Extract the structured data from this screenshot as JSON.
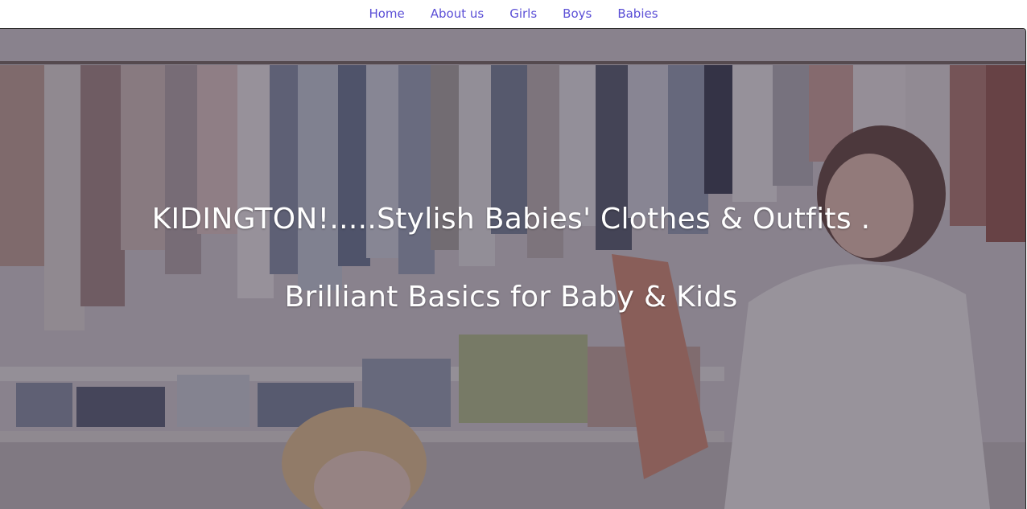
{
  "nav": {
    "items": [
      {
        "label": "Home"
      },
      {
        "label": "About us"
      },
      {
        "label": "Girls"
      },
      {
        "label": "Boys"
      },
      {
        "label": "Babies"
      }
    ]
  },
  "hero": {
    "headline": "KIDINGTON!.....Stylish Babies' Clothes & Outfits .",
    "subline": "Brilliant Basics for Baby & Kids"
  },
  "colors": {
    "nav_link": "#5b4fd6",
    "hero_text": "#ffffff",
    "overlay": "#28243a"
  }
}
